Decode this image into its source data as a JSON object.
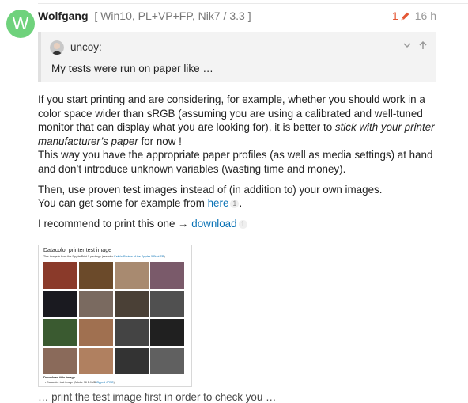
{
  "post": {
    "avatar_letter": "W",
    "avatar_color": "#6fd27c",
    "username": "Wolfgang",
    "user_title": "[ Win10, PL+VP+FP, Nik7 / 3.3 ]",
    "edit_count": "1",
    "time_ago": "16 h"
  },
  "quote": {
    "username": "uncoy:",
    "text": "My tests were run on paper like …"
  },
  "body": {
    "p1_a": "If you start printing and are considering, for example, whether you should work in a color space wider than sRGB (assuming you are using a calibrated and well-tuned monitor that can display what you are looking for), it is better to ",
    "p1_em": "stick with your printer manufacturer’s paper",
    "p1_b": " for now !",
    "p1_c": "This way you have the appropriate paper profiles (as well as media settings) at hand and don’t introduce unknown variables (wasting time and money).",
    "p2_a": "Then, use proven test images instead of (in addition to) your own images.",
    "p2_b": "You can get some for example from ",
    "p2_link": "here",
    "p2_badge": "1",
    "p2_end": ".",
    "p3_a": "I recommend to print this one → ",
    "p3_link": "download",
    "p3_badge": "1"
  },
  "preview": {
    "title": "Datacolor printer test image",
    "desc": "This image is from the SpyderPrint 5 package (see also ",
    "desc_link": "Keith's Review of the Spyder 5 Print SR",
    "desc_end": ")",
    "download_heading": "Download this image",
    "bullet": "• Datacolor test image (Adobe 98 1.9MB ",
    "bullet_link": "Zipped JPEG",
    "bullet_end": ")",
    "tile_colors": [
      "#8a3a2a",
      "#6b4a2a",
      "#a88a70",
      "#7a5a6a",
      "#1a1a20",
      "#7a6a60",
      "#4a4036",
      "#505050",
      "#3a5a30",
      "#a07050",
      "#444444",
      "#202020",
      "#8a6a5a",
      "#b08060",
      "#333333",
      "#606060"
    ]
  },
  "cut_text": "… print the test image first in order to check you …"
}
